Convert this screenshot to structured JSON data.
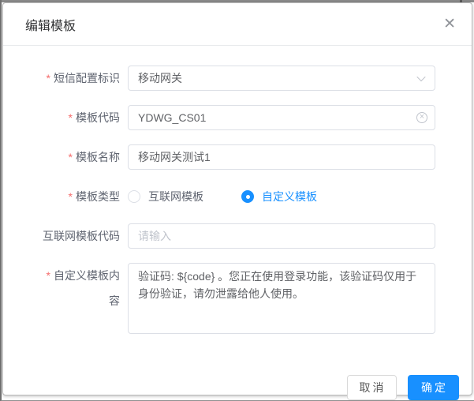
{
  "window": {
    "title": "编辑模板",
    "close_glyph": "✕"
  },
  "required_mark": "*",
  "form": {
    "sms_config": {
      "label": "短信配置标识",
      "value": "移动网关"
    },
    "template_code": {
      "label": "模板代码",
      "value": "YDWG_CS01",
      "clear_glyph": "×"
    },
    "template_name": {
      "label": "模板名称",
      "value": "移动网关测试1"
    },
    "template_type": {
      "label": "模板类型",
      "options": [
        {
          "label": "互联网模板",
          "selected": false
        },
        {
          "label": "自定义模板",
          "selected": true
        }
      ]
    },
    "internet_code": {
      "label": "互联网模板代码",
      "placeholder": "请输入"
    },
    "custom_content": {
      "label": "自定义模板内容",
      "value": "验证码: ${code} 。您正在使用登录功能，该验证码仅用于身份验证，请勿泄露给他人使用。"
    }
  },
  "footer": {
    "cancel": "取消",
    "confirm": "确定"
  },
  "colors": {
    "accent": "#1890ff",
    "required": "#f56c6c"
  }
}
